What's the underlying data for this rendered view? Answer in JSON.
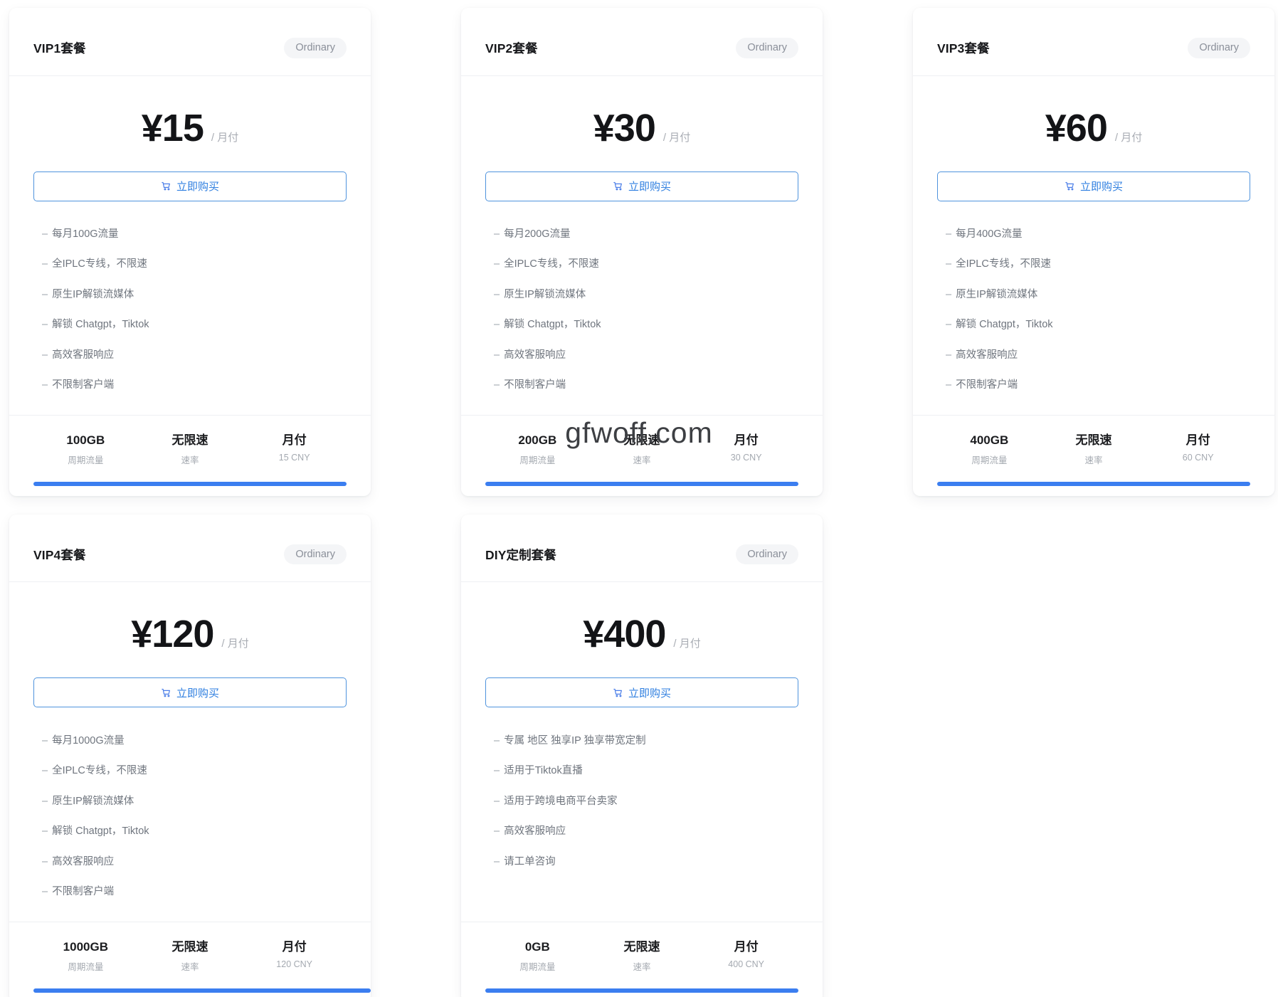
{
  "watermark": "gfwoff.com",
  "labels": {
    "badge": "Ordinary",
    "buy": "立即购买",
    "per_unit": "/ 月付",
    "stat_traffic_label": "周期流量",
    "stat_speed_label": "速率",
    "stat_cycle_label": "月付",
    "cart_icon": "cart-icon"
  },
  "plans": [
    {
      "title": "VIP1套餐",
      "badge": "Ordinary",
      "price": "¥15",
      "per": "/ 月付",
      "buy": "立即购买",
      "features": [
        "每月100G流量",
        "全IPLC专线，不限速",
        "原生IP解锁流媒体",
        "解锁 Chatgpt，Tiktok",
        "高效客服响应",
        "不限制客户端"
      ],
      "stats": [
        {
          "value": "100GB",
          "label": "周期流量"
        },
        {
          "value": "无限速",
          "label": "速率"
        },
        {
          "value": "月付",
          "label": "15 CNY"
        }
      ],
      "bar_color": "#3b7ef0"
    },
    {
      "title": "VIP2套餐",
      "badge": "Ordinary",
      "price": "¥30",
      "per": "/ 月付",
      "buy": "立即购买",
      "features": [
        "每月200G流量",
        "全IPLC专线，不限速",
        "原生IP解锁流媒体",
        "解锁 Chatgpt，Tiktok",
        "高效客服响应",
        "不限制客户端"
      ],
      "stats": [
        {
          "value": "200GB",
          "label": "周期流量"
        },
        {
          "value": "无限速",
          "label": "速率"
        },
        {
          "value": "月付",
          "label": "30 CNY"
        }
      ],
      "bar_color": "#3b7ef0"
    },
    {
      "title": "VIP3套餐",
      "badge": "Ordinary",
      "price": "¥60",
      "per": "/ 月付",
      "buy": "立即购买",
      "features": [
        "每月400G流量",
        "全IPLC专线，不限速",
        "原生IP解锁流媒体",
        "解锁 Chatgpt，Tiktok",
        "高效客服响应",
        "不限制客户端"
      ],
      "stats": [
        {
          "value": "400GB",
          "label": "周期流量"
        },
        {
          "value": "无限速",
          "label": "速率"
        },
        {
          "value": "月付",
          "label": "60 CNY"
        }
      ],
      "bar_color": "#3b7ef0"
    },
    {
      "title": "VIP4套餐",
      "badge": "Ordinary",
      "price": "¥120",
      "per": "/ 月付",
      "buy": "立即购买",
      "features": [
        "每月1000G流量",
        "全IPLC专线，不限速",
        "原生IP解锁流媒体",
        "解锁 Chatgpt，Tiktok",
        "高效客服响应",
        "不限制客户端"
      ],
      "stats": [
        {
          "value": "1000GB",
          "label": "周期流量"
        },
        {
          "value": "无限速",
          "label": "速率"
        },
        {
          "value": "月付",
          "label": "120 CNY"
        }
      ],
      "bar_color": "#3b7ef0"
    },
    {
      "title": "DIY定制套餐",
      "badge": "Ordinary",
      "price": "¥400",
      "per": "/ 月付",
      "buy": "立即购买",
      "features": [
        "专属 地区 独享IP 独享带宽定制",
        "适用于Tiktok直播",
        "适用于跨境电商平台卖家",
        "高效客服响应",
        "请工单咨询"
      ],
      "stats": [
        {
          "value": "0GB",
          "label": "周期流量"
        },
        {
          "value": "无限速",
          "label": "速率"
        },
        {
          "value": "月付",
          "label": "400 CNY"
        }
      ],
      "bar_color": "#3b7ef0"
    }
  ]
}
